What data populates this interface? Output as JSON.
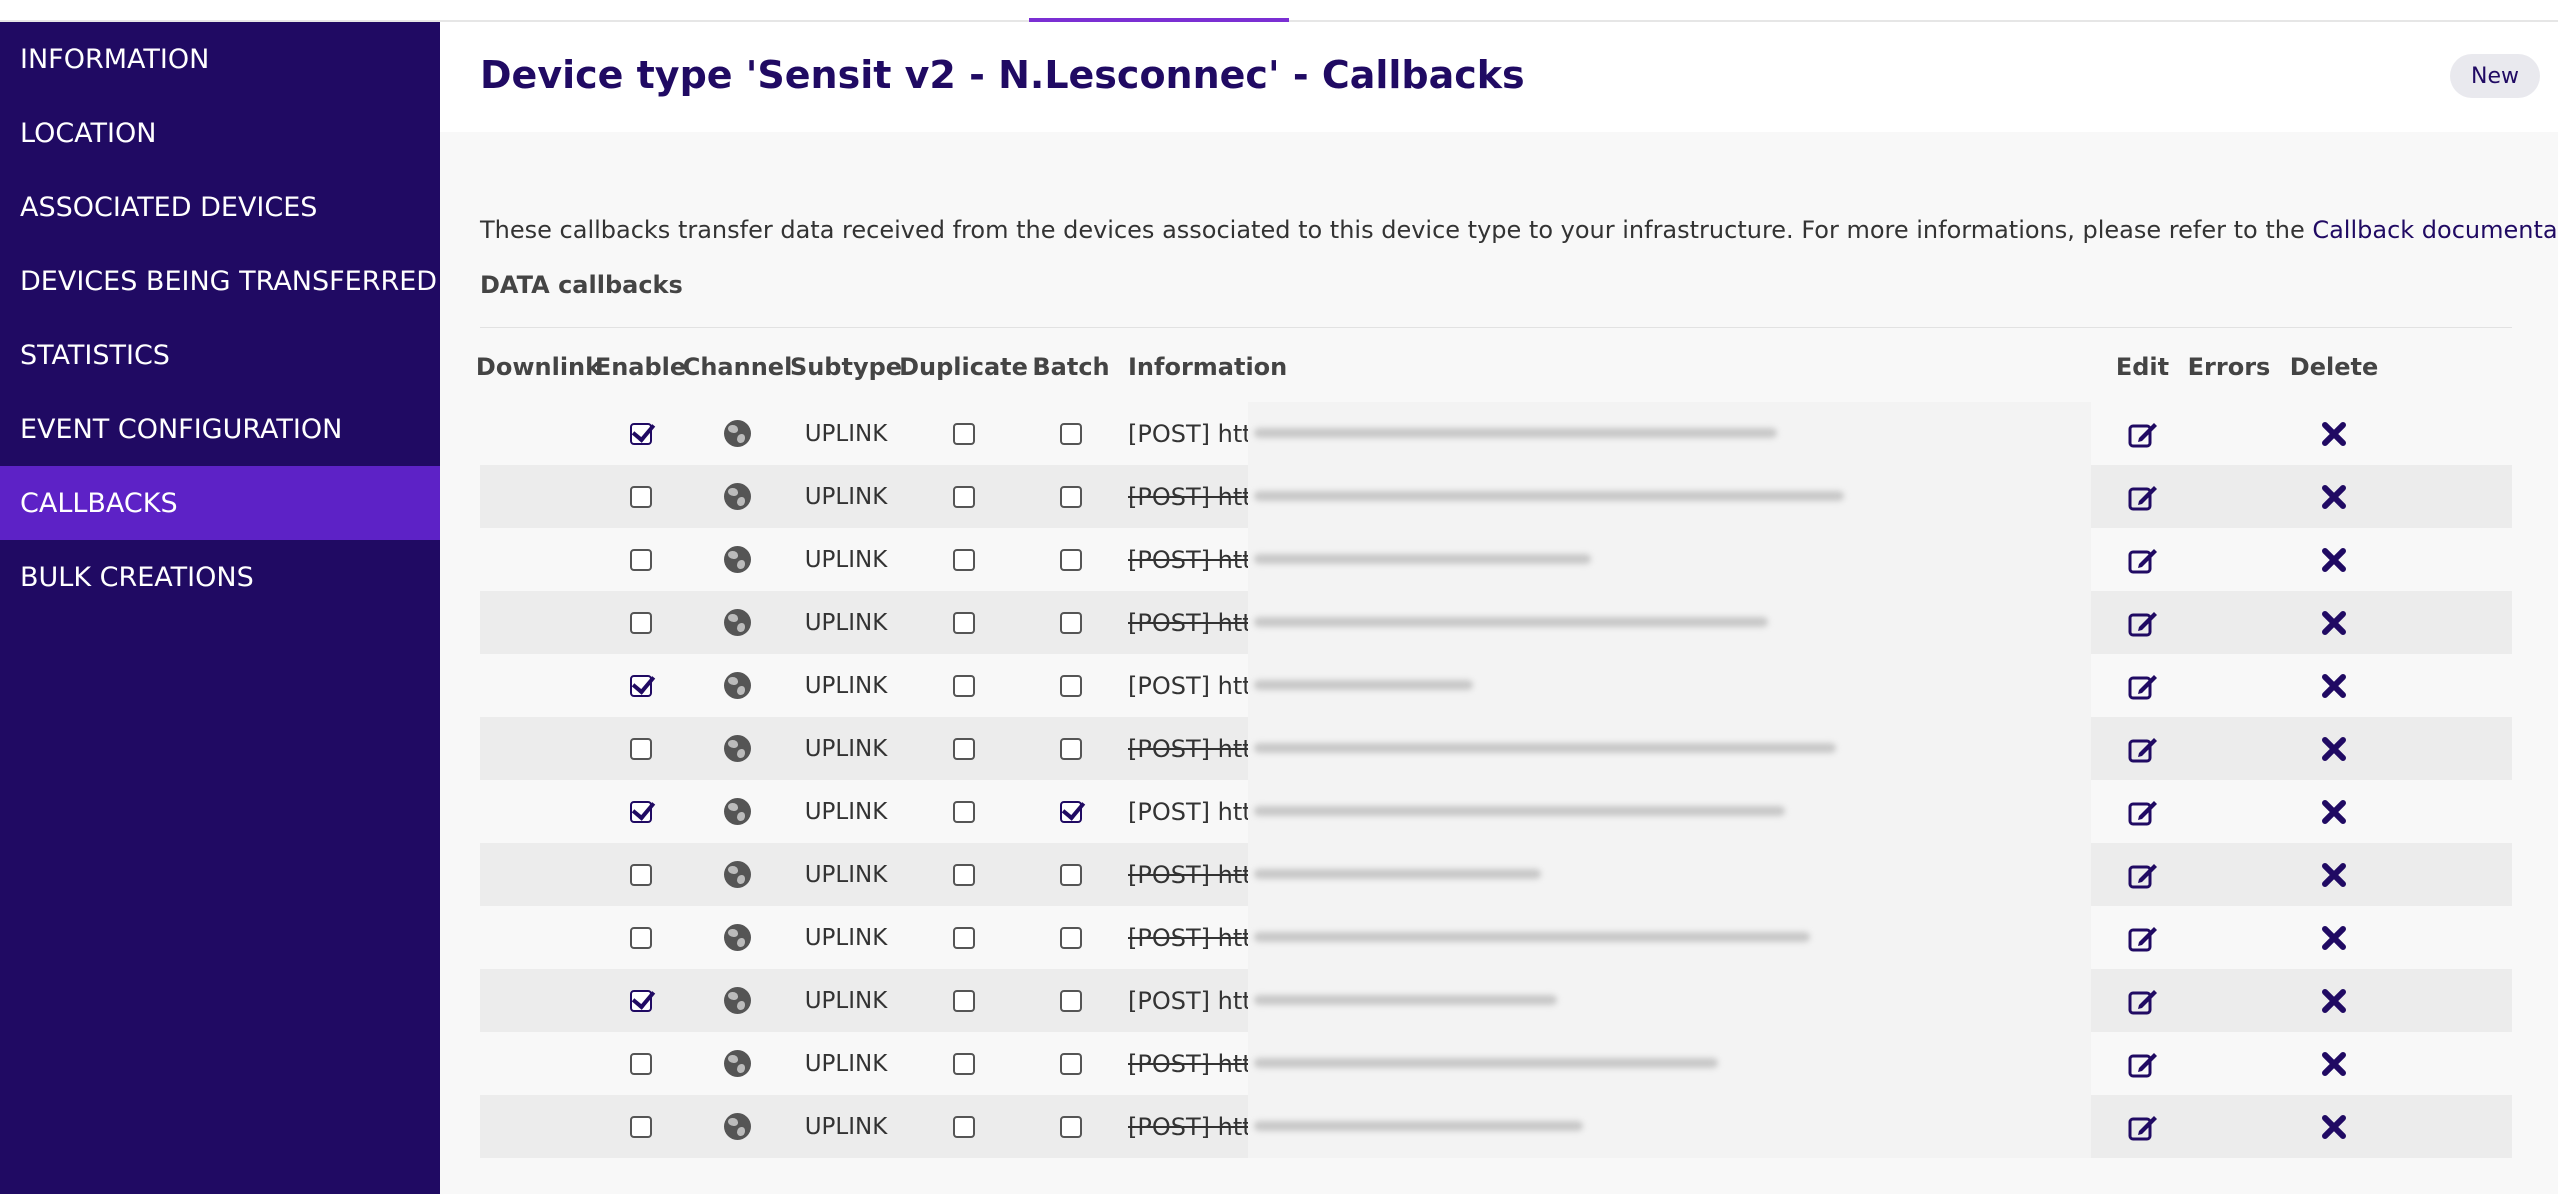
{
  "sidebar": {
    "items": [
      {
        "label": "INFORMATION",
        "active": false
      },
      {
        "label": "LOCATION",
        "active": false
      },
      {
        "label": "ASSOCIATED DEVICES",
        "active": false
      },
      {
        "label": "DEVICES BEING TRANSFERRED",
        "active": false
      },
      {
        "label": "STATISTICS",
        "active": false
      },
      {
        "label": "EVENT CONFIGURATION",
        "active": false
      },
      {
        "label": "CALLBACKS",
        "active": true
      },
      {
        "label": "BULK CREATIONS",
        "active": false
      }
    ]
  },
  "header": {
    "title": "Device type 'Sensit v2 - N.Lesconnec' - Callbacks",
    "new_button": "New"
  },
  "description": {
    "text": "These callbacks transfer data received from the devices associated to this device type to your infrastructure. For more informations, please refer to the ",
    "link": "Callback documentation"
  },
  "section_title": "DATA callbacks",
  "table": {
    "columns": [
      "Downlink",
      "Enable",
      "Channel",
      "Subtype",
      "Duplicate",
      "Batch",
      "Information",
      "Edit",
      "Errors",
      "Delete"
    ],
    "rows": [
      {
        "enable": true,
        "channel": "globe-icon",
        "subtype": "UPLINK",
        "duplicate": false,
        "batch": false,
        "info_prefix": "[POST] https",
        "info_tail": "&d...",
        "struck": false
      },
      {
        "enable": false,
        "channel": "globe-icon",
        "subtype": "UPLINK",
        "duplicate": false,
        "batch": false,
        "info_prefix": "[POST] https",
        "info_tail": "on...",
        "struck": true
      },
      {
        "enable": false,
        "channel": "globe-icon",
        "subtype": "UPLINK",
        "duplicate": false,
        "batch": false,
        "info_prefix": "[POST] https",
        "info_tail": "",
        "struck": true
      },
      {
        "enable": false,
        "channel": "globe-icon",
        "subtype": "UPLINK",
        "duplicate": false,
        "batch": false,
        "info_prefix": "[POST] https",
        "info_tail": "52...",
        "struck": true
      },
      {
        "enable": true,
        "channel": "globe-icon",
        "subtype": "UPLINK",
        "duplicate": false,
        "batch": false,
        "info_prefix": "[POST] https",
        "info_tail": "",
        "struck": false
      },
      {
        "enable": false,
        "channel": "globe-icon",
        "subtype": "UPLINK",
        "duplicate": false,
        "batch": false,
        "info_prefix": "[POST] https",
        "info_tail": "n=...",
        "struck": true
      },
      {
        "enable": true,
        "channel": "globe-icon",
        "subtype": "UPLINK",
        "duplicate": false,
        "batch": true,
        "info_prefix": "[POST] http:/",
        "info_tail": "e};...",
        "struck": false
      },
      {
        "enable": false,
        "channel": "globe-icon",
        "subtype": "UPLINK",
        "duplicate": false,
        "batch": false,
        "info_prefix": "[POST] http:/",
        "info_tail": "",
        "struck": true
      },
      {
        "enable": false,
        "channel": "globe-icon",
        "subtype": "UPLINK",
        "duplicate": false,
        "batch": false,
        "info_prefix": "[POST] https",
        "info_tail": "80...",
        "struck": true
      },
      {
        "enable": true,
        "channel": "globe-icon",
        "subtype": "UPLINK",
        "duplicate": false,
        "batch": false,
        "info_prefix": "[POST] https",
        "info_tail": "",
        "struck": false
      },
      {
        "enable": false,
        "channel": "globe-icon",
        "subtype": "UPLINK",
        "duplicate": false,
        "batch": false,
        "info_prefix": "[POST] https",
        "info_tail": "",
        "struck": true
      },
      {
        "enable": false,
        "channel": "globe-icon",
        "subtype": "UPLINK",
        "duplicate": false,
        "batch": false,
        "info_prefix": "[POST] https",
        "info_tail": "",
        "struck": true
      }
    ]
  },
  "colors": {
    "sidebar_bg": "#200a63",
    "sidebar_active": "#5d22c6",
    "accent": "#7b2fd3",
    "title": "#200a63"
  }
}
